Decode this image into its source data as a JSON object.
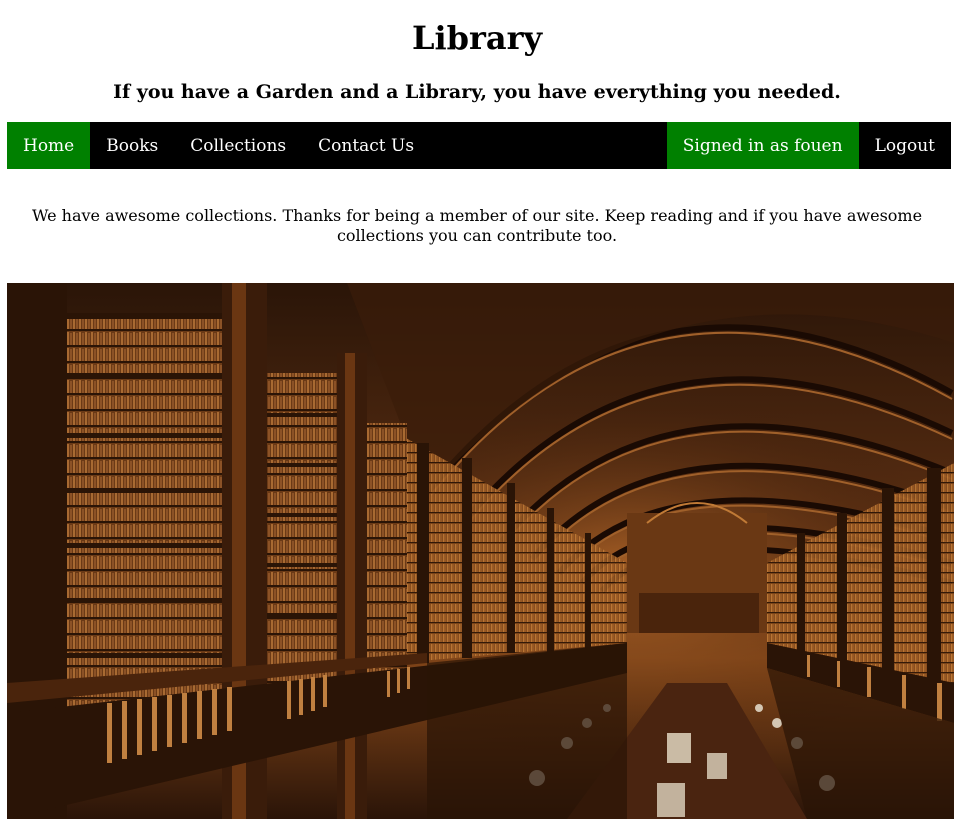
{
  "header": {
    "title": "Library",
    "tagline": "If you have a Garden and a Library, you have everything you needed."
  },
  "nav": {
    "items": [
      {
        "label": "Home",
        "active": true
      },
      {
        "label": "Books",
        "active": false
      },
      {
        "label": "Collections",
        "active": false
      },
      {
        "label": "Contact Us",
        "active": false
      }
    ],
    "signed_in_label": "Signed in as fouen",
    "logout_label": "Logout"
  },
  "main": {
    "welcome_text": "We have awesome collections. Thanks for being a member of our site. Keep reading and if you have awesome collections you can contribute too."
  },
  "colors": {
    "nav_background": "#000000",
    "active_green": "#008000",
    "nav_text": "#ffffff"
  }
}
